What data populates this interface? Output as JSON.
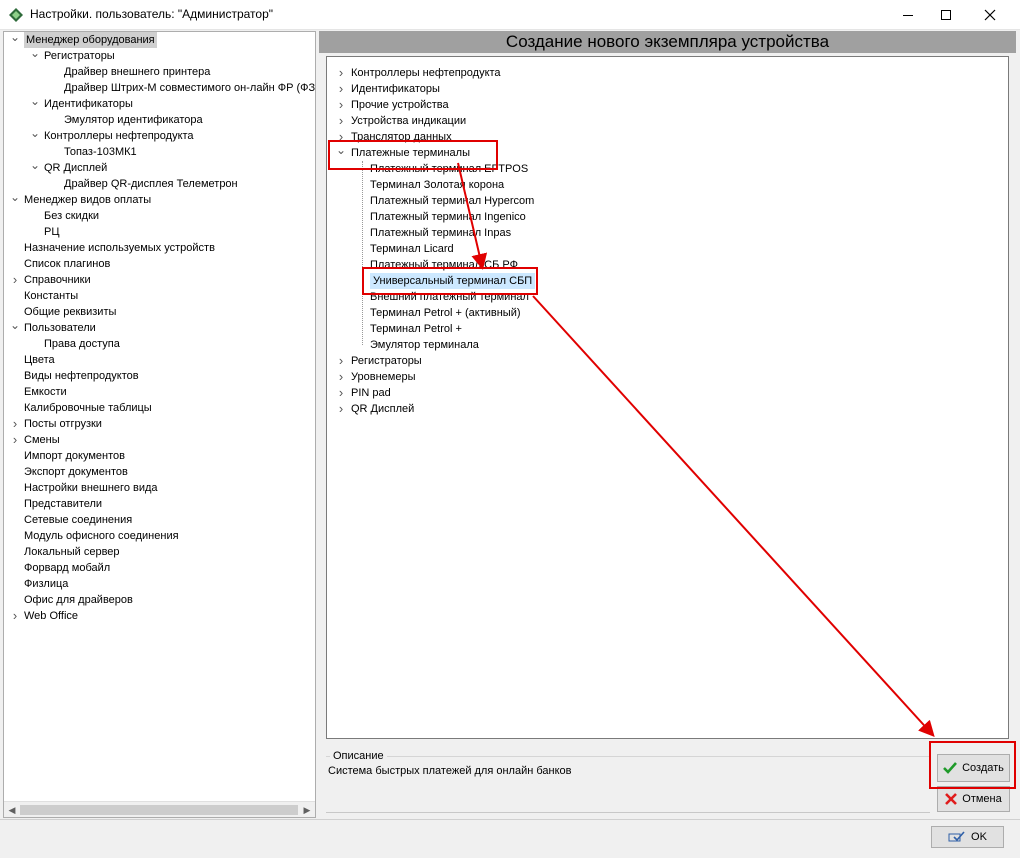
{
  "window": {
    "title": "Настройки. пользователь: \"Администратор\"",
    "min_glyph": "—",
    "close_glyph": "✕"
  },
  "left_tree": [
    {
      "label": "Менеджер оборудования",
      "level": 0,
      "arrow": "expanded",
      "selected": true
    },
    {
      "label": "Регистраторы",
      "level": 1,
      "arrow": "expanded"
    },
    {
      "label": "Драйвер внешнего принтера",
      "level": 2,
      "arrow": "none"
    },
    {
      "label": "Драйвер Штрих-М совместимого он-лайн ФР (ФЗ",
      "level": 2,
      "arrow": "none"
    },
    {
      "label": "Идентификаторы",
      "level": 1,
      "arrow": "expanded"
    },
    {
      "label": "Эмулятор идентификатора",
      "level": 2,
      "arrow": "none"
    },
    {
      "label": "Контроллеры нефтепродукта",
      "level": 1,
      "arrow": "expanded"
    },
    {
      "label": "Топаз-103МК1",
      "level": 2,
      "arrow": "none"
    },
    {
      "label": "QR Дисплей",
      "level": 1,
      "arrow": "expanded"
    },
    {
      "label": "Драйвер QR-дисплея Телеметрон",
      "level": 2,
      "arrow": "none"
    },
    {
      "label": "Менеджер видов оплаты",
      "level": 0,
      "arrow": "expanded"
    },
    {
      "label": "Без скидки",
      "level": 1,
      "arrow": "none"
    },
    {
      "label": "РЦ",
      "level": 1,
      "arrow": "none"
    },
    {
      "label": "Назначение используемых устройств",
      "level": 0,
      "arrow": "none"
    },
    {
      "label": "Список плагинов",
      "level": 0,
      "arrow": "none"
    },
    {
      "label": "Справочники",
      "level": 0,
      "arrow": "collapsed"
    },
    {
      "label": "Константы",
      "level": 0,
      "arrow": "none"
    },
    {
      "label": "Общие реквизиты",
      "level": 0,
      "arrow": "none"
    },
    {
      "label": "Пользователи",
      "level": 0,
      "arrow": "expanded"
    },
    {
      "label": "Права доступа",
      "level": 1,
      "arrow": "none"
    },
    {
      "label": "Цвета",
      "level": 0,
      "arrow": "none"
    },
    {
      "label": "Виды нефтепродуктов",
      "level": 0,
      "arrow": "none"
    },
    {
      "label": "Емкости",
      "level": 0,
      "arrow": "none"
    },
    {
      "label": "Калибровочные таблицы",
      "level": 0,
      "arrow": "none"
    },
    {
      "label": "Посты отгрузки",
      "level": 0,
      "arrow": "collapsed"
    },
    {
      "label": "Смены",
      "level": 0,
      "arrow": "collapsed"
    },
    {
      "label": "Импорт документов",
      "level": 0,
      "arrow": "none"
    },
    {
      "label": "Экспорт документов",
      "level": 0,
      "arrow": "none"
    },
    {
      "label": "Настройки внешнего вида",
      "level": 0,
      "arrow": "none"
    },
    {
      "label": "Представители",
      "level": 0,
      "arrow": "none"
    },
    {
      "label": "Сетевые соединения",
      "level": 0,
      "arrow": "none"
    },
    {
      "label": "Модуль офисного соединения",
      "level": 0,
      "arrow": "none"
    },
    {
      "label": "Локальный сервер",
      "level": 0,
      "arrow": "none"
    },
    {
      "label": "Форвард мобайл",
      "level": 0,
      "arrow": "none"
    },
    {
      "label": "Физлица",
      "level": 0,
      "arrow": "none"
    },
    {
      "label": "Офис для драйверов",
      "level": 0,
      "arrow": "none"
    },
    {
      "label": "Web Office",
      "level": 0,
      "arrow": "collapsed"
    }
  ],
  "main": {
    "header_title": "Создание нового экземпляра устройства",
    "device_tree": [
      {
        "label": "Контроллеры нефтепродукта",
        "level": 0,
        "arrow": "collapsed"
      },
      {
        "label": "Идентификаторы",
        "level": 0,
        "arrow": "collapsed"
      },
      {
        "label": "Прочие устройства",
        "level": 0,
        "arrow": "collapsed"
      },
      {
        "label": "Устройства индикации",
        "level": 0,
        "arrow": "collapsed"
      },
      {
        "label": "Транслятор данных",
        "level": 0,
        "arrow": "collapsed"
      },
      {
        "label": "Платежные терминалы",
        "level": 0,
        "arrow": "expanded"
      },
      {
        "label": "Платежный терминал EFTPOS",
        "level": 1,
        "arrow": "none"
      },
      {
        "label": "Терминал Золотая корона",
        "level": 1,
        "arrow": "none"
      },
      {
        "label": "Платежный терминал Hypercom",
        "level": 1,
        "arrow": "none"
      },
      {
        "label": "Платежный терминал Ingenico",
        "level": 1,
        "arrow": "none"
      },
      {
        "label": "Платежный терминал Inpas",
        "level": 1,
        "arrow": "none"
      },
      {
        "label": "Терминал Licard",
        "level": 1,
        "arrow": "none"
      },
      {
        "label": "Платежный терминал СБ РФ",
        "level": 1,
        "arrow": "none"
      },
      {
        "label": "Универсальный терминал СБП",
        "level": 1,
        "arrow": "none",
        "selected": true
      },
      {
        "label": "Внешний платежный терминал",
        "level": 1,
        "arrow": "none"
      },
      {
        "label": "Терминал Petrol + (активный)",
        "level": 1,
        "arrow": "none"
      },
      {
        "label": "Терминал Petrol +",
        "level": 1,
        "arrow": "none"
      },
      {
        "label": "Эмулятор терминала",
        "level": 1,
        "arrow": "none"
      },
      {
        "label": "Регистраторы",
        "level": 0,
        "arrow": "collapsed"
      },
      {
        "label": "Уровнемеры",
        "level": 0,
        "arrow": "collapsed"
      },
      {
        "label": "PIN pad",
        "level": 0,
        "arrow": "collapsed"
      },
      {
        "label": "QR Дисплей",
        "level": 0,
        "arrow": "collapsed"
      }
    ],
    "description_label": "Описание",
    "description_text": "Система быстрых платежей для онлайн банков"
  },
  "buttons": {
    "create": "Создать",
    "cancel": "Отмена",
    "ok": "OK"
  },
  "colors": {
    "annotation_red": "#e00000",
    "selection_blue": "#cce8ff",
    "header_gray": "#a0a0a0"
  }
}
